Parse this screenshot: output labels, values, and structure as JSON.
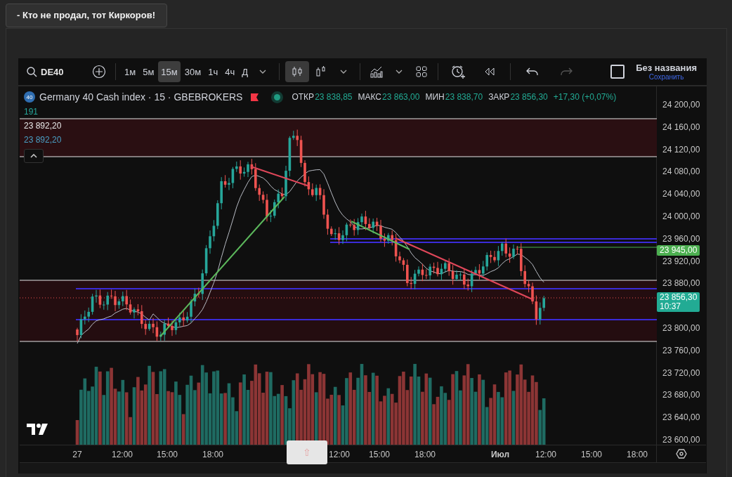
{
  "post_title": "- Кто не продал, тот Киркоров!",
  "toolbar": {
    "symbol": "DE40",
    "intervals": [
      {
        "label": "1м",
        "selected": false
      },
      {
        "label": "5м",
        "selected": false
      },
      {
        "label": "15м",
        "selected": true
      },
      {
        "label": "30м",
        "selected": false
      },
      {
        "label": "1ч",
        "selected": false
      },
      {
        "label": "4ч",
        "selected": false
      },
      {
        "label": "Д",
        "selected": false
      }
    ],
    "tools": [
      {
        "kind": "candles",
        "selected": true
      },
      {
        "kind": "bars",
        "selected": false
      },
      {
        "kind": "chevron"
      },
      {
        "kind": "divider"
      },
      {
        "kind": "indicators"
      },
      {
        "kind": "chevron"
      },
      {
        "kind": "layout"
      },
      {
        "kind": "divider"
      },
      {
        "kind": "alert"
      },
      {
        "kind": "replay"
      },
      {
        "kind": "divider"
      },
      {
        "kind": "undo",
        "disabled": false
      },
      {
        "kind": "redo",
        "disabled": true
      }
    ],
    "layout_checkbox": {
      "checked": false
    },
    "layout_name": "Без названия",
    "save_link": "Сохранить"
  },
  "legend": {
    "badge": "40",
    "title": "Germany 40 Cash index · 15 · GBEBROKERS",
    "ohlc": [
      {
        "label": "ОТКР",
        "value": "23 838,85"
      },
      {
        "label": "МАКС",
        "value": "23 863,00"
      },
      {
        "label": "МИН",
        "value": "23 838,70"
      },
      {
        "label": "ЗАКР",
        "value": "23 856,30"
      }
    ],
    "change": "+17,30 (+0,07%)",
    "volume": "191",
    "lines": [
      {
        "text": "23 892,20",
        "color": "#e8e8e8"
      },
      {
        "text": "23 892,20",
        "color": "#4a9fc4"
      }
    ]
  },
  "price_axis": {
    "labels": [
      "24 200,00",
      "24 160,00",
      "24 120,00",
      "24 080,00",
      "24 040,00",
      "24 000,00",
      "23 960,00",
      "23 920,00",
      "23 880,00",
      "23 800,00",
      "23 760,00",
      "23 720,00",
      "23 680,00",
      "23 640,00",
      "23 600,00"
    ],
    "tags": [
      {
        "text": "23 945,00",
        "color": "#4caf50"
      },
      {
        "text": "23 856,30",
        "sub": "10:37",
        "color": "#22ab94"
      }
    ]
  },
  "time_axis": {
    "labels": [
      "27",
      "12:00",
      "15:00",
      "18:00",
      "12:00",
      "15:00",
      "18:00",
      "Июл",
      "12:00",
      "15:00",
      "18:00"
    ]
  },
  "scroll_button": {
    "label": "⇧"
  }
}
